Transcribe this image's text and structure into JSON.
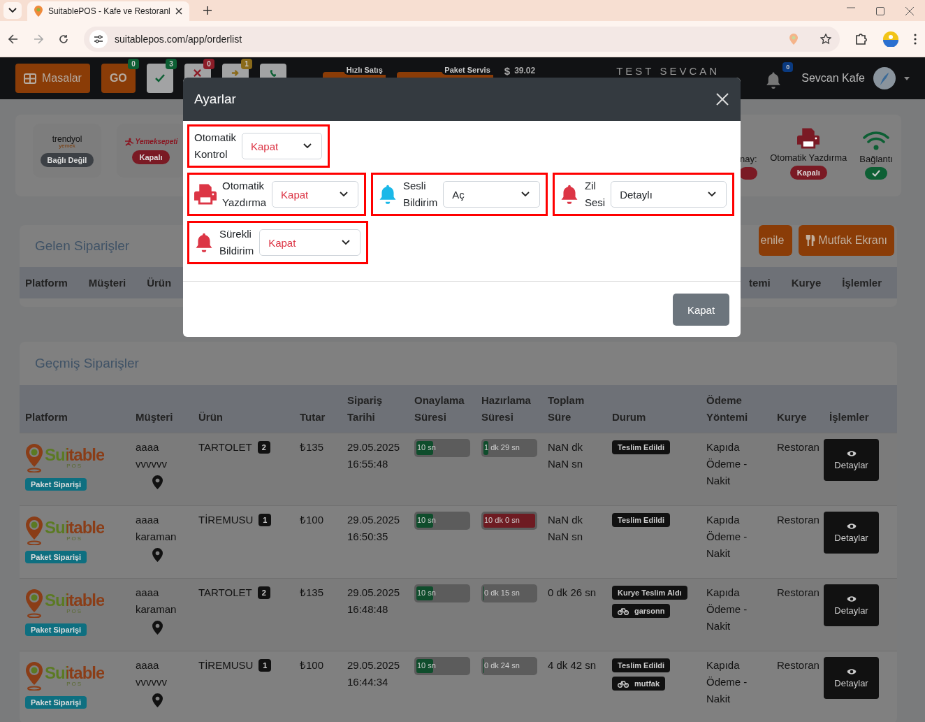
{
  "browser": {
    "tab_title": "SuitablePOS - Kafe ve Restoranl",
    "url": "suitablepos.com/app/orderlist"
  },
  "navbar": {
    "buttons": [
      {
        "kind": "tables",
        "label": "Masalar"
      },
      {
        "kind": "go",
        "label": "GO",
        "badge": "0",
        "color": "#0d5f34"
      },
      {
        "kind": "check",
        "badge": "3",
        "color": "#0d5f34"
      },
      {
        "kind": "cross",
        "badge": "0",
        "color": "#8c1d28"
      },
      {
        "kind": "arrow",
        "badge": "1",
        "color": "#8a6a1a"
      },
      {
        "kind": "phone"
      }
    ],
    "quick_links": [
      {
        "kind": "register",
        "label": "Hızlı Satış"
      },
      {
        "kind": "delivery",
        "label": "Paket Servis"
      }
    ],
    "currency": "$",
    "balance": "39.02",
    "title": "TEST SEVCAN",
    "notifications": "0",
    "user": "Sevcan Kafe"
  },
  "integrations": [
    {
      "kind": "trendyol",
      "logo": "trendyol",
      "logo_sub": "yemek",
      "status": "Bağlı Değil",
      "color": "#3c4045"
    },
    {
      "kind": "yemeksepeti",
      "logo": "Yemeksepeti",
      "status": "Kapalı",
      "color": "#7a1a24"
    }
  ],
  "indicators": [
    {
      "kind": "partial",
      "label": "nay:",
      "color": "#7a1a24"
    },
    {
      "kind": "printer",
      "label": "Otomatik Yazdırma",
      "status": "Kapalı",
      "color": "#7a1a24"
    },
    {
      "kind": "wifi",
      "label": "Bağlantı",
      "color": "#0d5f34"
    }
  ],
  "incoming": {
    "title": "Gelen Siparişler",
    "buttons": [
      {
        "kind": "refresh",
        "label": "enile"
      },
      {
        "kind": "kitchen",
        "label": "Mutfak Ekranı"
      }
    ],
    "columns_left": [
      "Platform",
      "Müşteri",
      "Ürün"
    ],
    "columns_right": [
      "temi",
      "Kurye",
      "İşlemler"
    ]
  },
  "history": {
    "title": "Geçmiş Siparişler",
    "columns": [
      "Platform",
      "Müşteri",
      "Ürün",
      "Tutar",
      "Sipariş Tarihi",
      "Onaylama Süresi",
      "Hazırlama Süresi",
      "Toplam Süre",
      "Durum",
      "Ödeme Yöntemi",
      "Kurye",
      "İşlemler"
    ],
    "rows": [
      {
        "logo": "Suitable",
        "logo_sub": "POS",
        "order_type": "Paket Siparişi",
        "customer": "aaaa vvvvvv",
        "product": "TARTOLET",
        "quantity": "2",
        "amount": "₺135",
        "date": "29.05.2025",
        "time": "16:55:48",
        "approval": {
          "label": "10 sn",
          "level": 0.33,
          "color": "#0f4d2c"
        },
        "preparation": {
          "label": "1 dk 29 sn",
          "level": 0.1,
          "color": "#0f4d2c"
        },
        "total": "NaN dk NaN sn",
        "statuses": [
          {
            "kind": "status",
            "label": "Teslim Edildi"
          }
        ],
        "payment": "Kapıda Ödeme - Nakit",
        "courier": "Restoran",
        "action": "Detaylar"
      },
      {
        "logo": "Suitable",
        "logo_sub": "POS",
        "order_type": "Paket Siparişi",
        "customer": "aaaa karaman",
        "product": "TİREMUSU",
        "quantity": "1",
        "amount": "₺100",
        "date": "29.05.2025",
        "time": "16:50:35",
        "approval": {
          "label": "10 sn",
          "level": 0.33,
          "color": "#0f4d2c"
        },
        "preparation": {
          "label": "10 dk 0 sn",
          "level": 1,
          "color": "#6e1b22"
        },
        "total": "NaN dk NaN sn",
        "statuses": [
          {
            "kind": "status",
            "label": "Teslim Edildi"
          }
        ],
        "payment": "Kapıda Ödeme - Nakit",
        "courier": "Restoran",
        "action": "Detaylar"
      },
      {
        "logo": "Suitable",
        "logo_sub": "POS",
        "order_type": "Paket Siparişi",
        "customer": "aaaa karaman",
        "product": "TARTOLET",
        "quantity": "2",
        "amount": "₺135",
        "date": "29.05.2025",
        "time": "16:48:48",
        "approval": {
          "label": "10 sn",
          "level": 0.33,
          "color": "#0f4d2c"
        },
        "preparation": {
          "label": "0 dk 15 sn",
          "level": 0.02,
          "color": "#0f4d2c"
        },
        "total": "0 dk 26 sn",
        "statuses": [
          {
            "kind": "status",
            "label": "Kurye Teslim Aldı"
          },
          {
            "kind": "courier",
            "label": "garsonn"
          }
        ],
        "payment": "Kapıda Ödeme - Nakit",
        "courier": "Restoran",
        "action": "Detaylar"
      },
      {
        "logo": "Suitable",
        "logo_sub": "POS",
        "order_type": "Paket Siparişi",
        "customer": "aaaa vvvvvv",
        "product": "TİREMUSU",
        "quantity": "1",
        "amount": "₺100",
        "date": "29.05.2025",
        "time": "16:44:34",
        "approval": {
          "label": "10 sn",
          "level": 0.33,
          "color": "#0f4d2c"
        },
        "preparation": {
          "label": "0 dk 24 sn",
          "level": 0.02,
          "color": "#0f4d2c"
        },
        "total": "4 dk 42 sn",
        "statuses": [
          {
            "kind": "status",
            "label": "Teslim Edildi"
          },
          {
            "kind": "courier",
            "label": "mutfak"
          }
        ],
        "payment": "Kapıda Ödeme - Nakit",
        "courier": "Restoran",
        "action": "Detaylar"
      }
    ]
  },
  "modal": {
    "title": "Ayarlar",
    "rows": [
      [
        {
          "kind": "plain",
          "label": "Otomatik Kontrol",
          "value": "Kapat",
          "enabled": false
        }
      ],
      [
        {
          "kind": "printer",
          "color": "#dc3545",
          "label": "Otomatik Yazdırma",
          "value": "Kapat",
          "enabled": false
        },
        {
          "kind": "bell",
          "color": "#1bb8e8",
          "label": "Sesli Bildirim",
          "value": "Aç",
          "enabled": true
        },
        {
          "kind": "bell",
          "color": "#dc3545",
          "label": "Zil Sesi",
          "value": "Detaylı",
          "enabled": true
        }
      ],
      [
        {
          "kind": "bell",
          "color": "#dc3545",
          "label": "Sürekli Bildirim",
          "value": "Kapat",
          "enabled": false
        }
      ]
    ],
    "close_button": "Kapat"
  }
}
